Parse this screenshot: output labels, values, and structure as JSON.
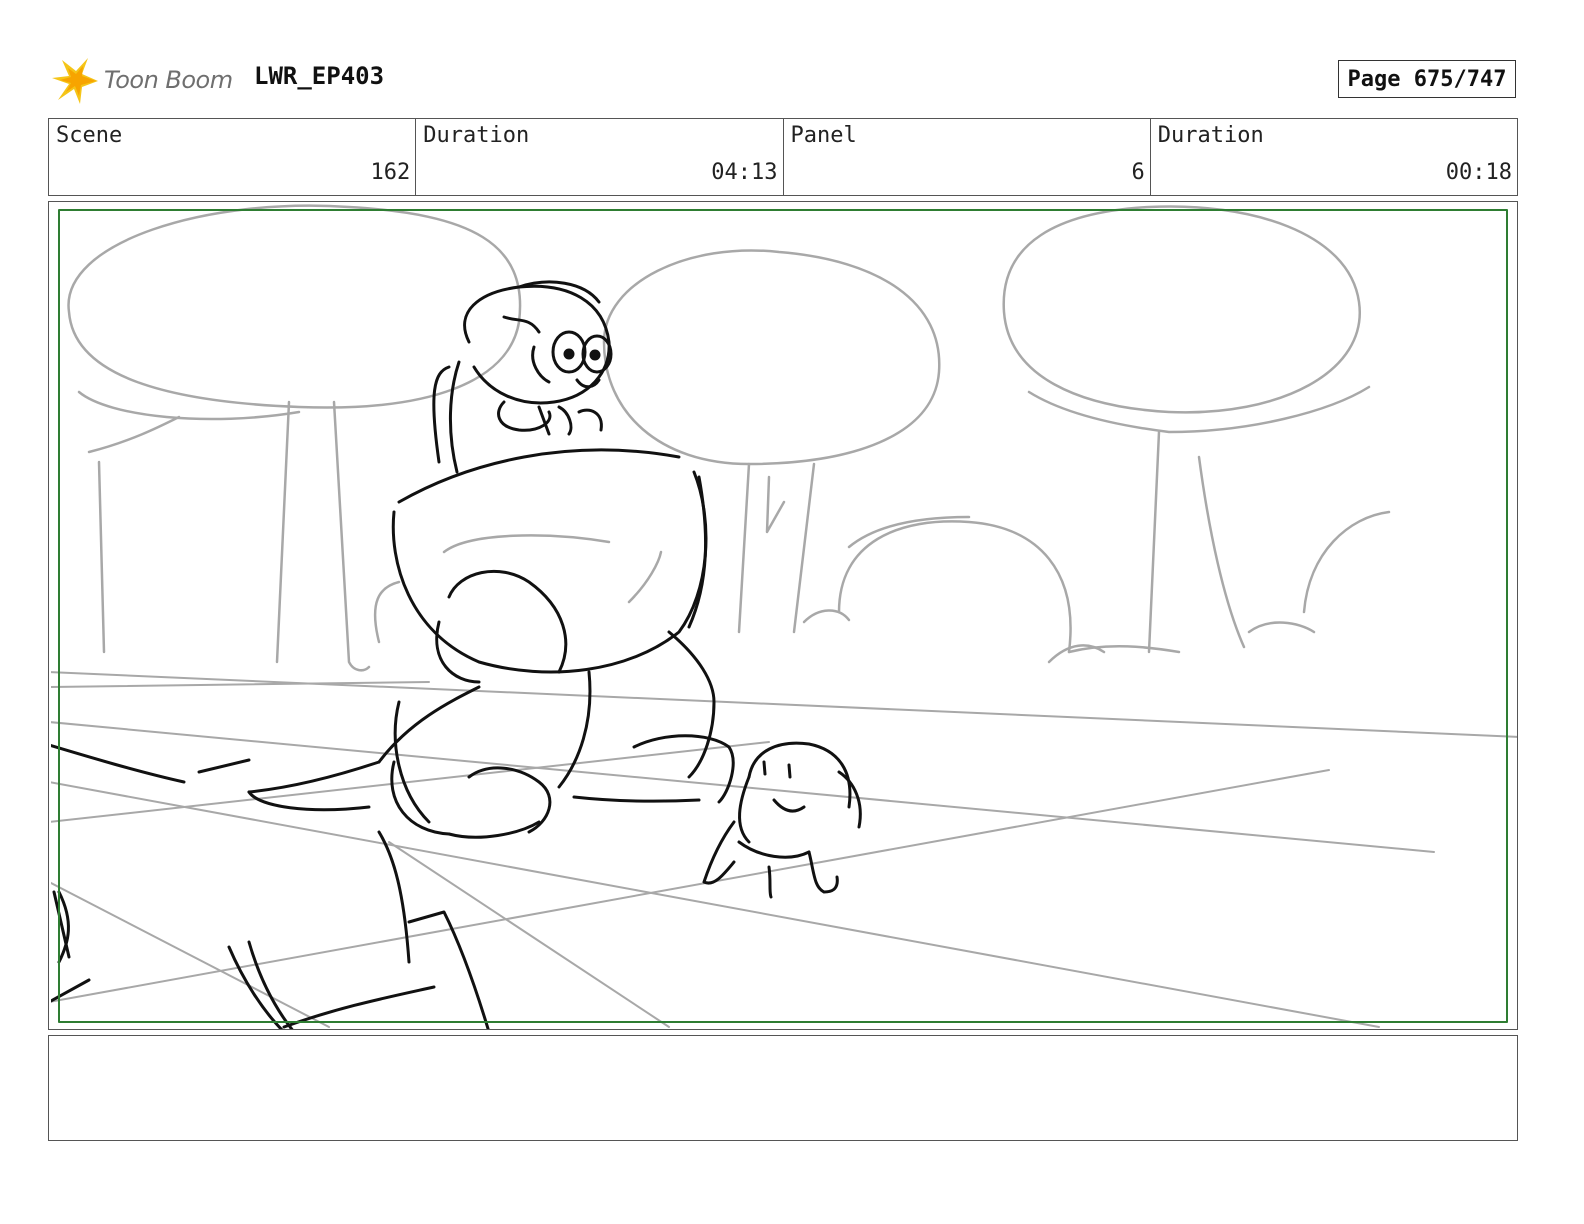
{
  "header": {
    "logo_text": "Toon Boom",
    "logo_icon": "toon-boom-starburst-icon",
    "project": "LWR_EP403",
    "page_label": "Page 675/747"
  },
  "info": {
    "scene_label": "Scene",
    "scene_value": "162",
    "scene_duration_label": "Duration",
    "scene_duration_value": "04:13",
    "panel_label": "Panel",
    "panel_value": "6",
    "panel_duration_label": "Duration",
    "panel_duration_value": "00:18"
  },
  "colors": {
    "safe_frame": "#2e7d32",
    "background_sketch": "#a8a8a8",
    "character_sketch": "#111111",
    "logo_star": "#f5c518"
  }
}
